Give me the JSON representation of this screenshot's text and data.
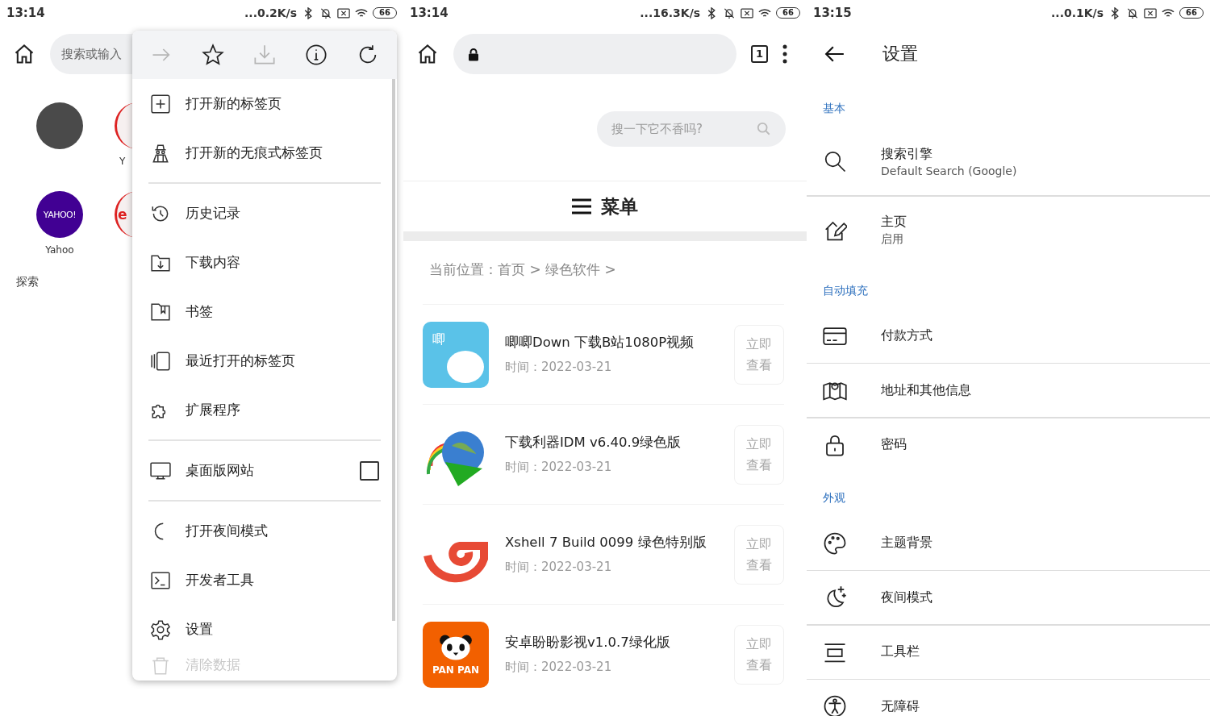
{
  "browser_menu_screen": {
    "status_bar": {
      "time": "13:14",
      "speed": "...0.2K/s",
      "battery": "66"
    },
    "search_field": {
      "placeholder": "搜索或输入"
    },
    "shortcuts": [
      {
        "kind": "blank"
      },
      {
        "kind": "partial",
        "label": "Y"
      },
      {
        "kind": "yahoo",
        "logo_text": "YAHOO!",
        "label": "Yahoo"
      },
      {
        "kind": "partial",
        "logo_text": "e"
      }
    ],
    "section_label": "探索",
    "menu": {
      "toolbar": [
        {
          "kind": "forward",
          "disabled": true
        },
        {
          "kind": "star",
          "disabled": false
        },
        {
          "kind": "download",
          "disabled": true
        },
        {
          "kind": "info",
          "disabled": false
        },
        {
          "kind": "refresh",
          "disabled": false
        }
      ],
      "groups": [
        [
          {
            "kind": "new_tab",
            "label": "打开新的标签页"
          },
          {
            "kind": "incognito",
            "label": "打开新的无痕式标签页"
          }
        ],
        [
          {
            "kind": "history",
            "label": "历史记录"
          },
          {
            "kind": "downloads",
            "label": "下载内容"
          },
          {
            "kind": "bookmarks",
            "label": "书签"
          },
          {
            "kind": "recent_tabs",
            "label": "最近打开的标签页"
          },
          {
            "kind": "extensions",
            "label": "扩展程序"
          }
        ],
        [
          {
            "kind": "desktop",
            "label": "桌面版网站",
            "checked": false
          }
        ],
        [
          {
            "kind": "night",
            "label": "打开夜间模式"
          },
          {
            "kind": "devtools",
            "label": "开发者工具"
          },
          {
            "kind": "settings",
            "label": "设置"
          },
          {
            "kind": "clear",
            "label": "清除数据",
            "faded": true
          }
        ]
      ]
    }
  },
  "webpage_screen": {
    "status_bar": {
      "time": "13:14",
      "speed": "...16.3K/s",
      "battery": "66"
    },
    "tab_count": "1",
    "site_search": {
      "placeholder": "搜一下它不香吗?"
    },
    "menu_label": "菜单",
    "breadcrumb": "当前位置：首页 > 绿色软件 >",
    "articles": [
      {
        "kind": "bunny",
        "logo_text": "唧",
        "title": "唧唧Down 下载B站1080P视频",
        "date": "时间：2022-03-21",
        "button": "立即查看"
      },
      {
        "kind": "globe",
        "title": "下载利器IDM v6.40.9绿色版",
        "date": "时间：2022-03-21",
        "button": "立即查看"
      },
      {
        "kind": "spiral",
        "title": "Xshell 7 Build 0099 绿色特别版",
        "date": "时间：2022-03-21",
        "button": "立即查看"
      },
      {
        "kind": "panda",
        "logo_text": "PAN PAN",
        "title": "安卓盼盼影视v1.0.7绿化版",
        "date": "时间：2022-03-21",
        "button": "立即查看"
      }
    ]
  },
  "settings_screen": {
    "status_bar": {
      "time": "13:15",
      "speed": "...0.1K/s",
      "battery": "66"
    },
    "title": "设置",
    "sections": [
      {
        "header": "基本",
        "items": [
          {
            "kind": "search",
            "title": "搜索引擎",
            "subtitle": "Default Search (Google)"
          },
          {
            "kind": "homepage",
            "title": "主页",
            "subtitle": "启用"
          }
        ]
      },
      {
        "header": "自动填充",
        "items": [
          {
            "kind": "card",
            "title": "付款方式"
          },
          {
            "kind": "map",
            "title": "地址和其他信息"
          },
          {
            "kind": "lock",
            "title": "密码"
          }
        ]
      },
      {
        "header": "外观",
        "items": [
          {
            "kind": "palette",
            "title": "主题背景"
          },
          {
            "kind": "night",
            "title": "夜间模式"
          },
          {
            "kind": "toolbar",
            "title": "工具栏"
          },
          {
            "kind": "accessibility",
            "title": "无障碍"
          }
        ]
      }
    ]
  }
}
